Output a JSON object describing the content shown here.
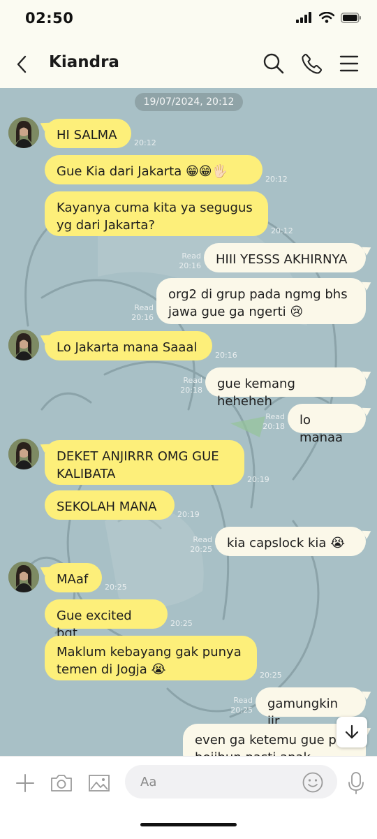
{
  "status_bar": {
    "time": "02:50"
  },
  "header": {
    "contact_name": "Kiandra",
    "back_icon": "chevron-left-icon",
    "search_icon": "search-icon",
    "call_icon": "phone-icon",
    "menu_icon": "menu-icon"
  },
  "chat": {
    "date_label": "19/07/2024, 20:12",
    "messages": [
      {
        "dir": "in",
        "text": "HI SALMA",
        "time": "20:12"
      },
      {
        "dir": "in",
        "text": "Gue Kia dari Jakarta 😁😁🖐🏻",
        "time": "20:12"
      },
      {
        "dir": "in",
        "text": "Kayanya cuma kita ya segugus\nyg dari Jakarta?",
        "time": "20:12"
      },
      {
        "dir": "out",
        "text": "HIII YESSS AKHIRNYA",
        "status": "Read",
        "time": "20:16"
      },
      {
        "dir": "out",
        "text": "org2 di grup pada ngmg bhs\njawa gue ga ngerti 😢",
        "status": "Read",
        "time": "20:16"
      },
      {
        "dir": "in",
        "text": "Lo Jakarta mana Saaal",
        "time": "20:16"
      },
      {
        "dir": "out",
        "text": "gue kemang heheheh",
        "status": "Read",
        "time": "20:18"
      },
      {
        "dir": "out",
        "text": "lo manaa",
        "status": "Read",
        "time": "20:18"
      },
      {
        "dir": "in",
        "text": "DEKET ANJIRRR OMG GUE\nKALIBATA",
        "time": "20:19"
      },
      {
        "dir": "in",
        "text": "SEKOLAH MANA",
        "time": "20:19"
      },
      {
        "dir": "out",
        "text": "kia capslock kia 😭",
        "status": "Read",
        "time": "20:25"
      },
      {
        "dir": "in",
        "text": "MAaf",
        "time": "20:25"
      },
      {
        "dir": "in",
        "text": "Gue excited bgt",
        "time": "20:25"
      },
      {
        "dir": "in",
        "text": "Maklum kebayang gak punya\ntemen di Jogja 😭",
        "time": "20:25"
      },
      {
        "dir": "out",
        "text": "gamungkin jir",
        "status": "Read",
        "time": "20:25"
      },
      {
        "dir": "out",
        "text": "even ga ketemu gue pu\nbeiibun pasti anak"
      }
    ],
    "scroll_down_icon": "arrow-down-icon"
  },
  "input_bar": {
    "placeholder": "Aa",
    "icons": [
      "plus-icon",
      "camera-icon",
      "image-icon",
      "emoji-icon",
      "microphone-icon"
    ]
  },
  "colors": {
    "incoming_bubble": "#fdef7a",
    "outgoing_bubble": "#fbf8e9",
    "chat_background": "#a8c0c6"
  }
}
